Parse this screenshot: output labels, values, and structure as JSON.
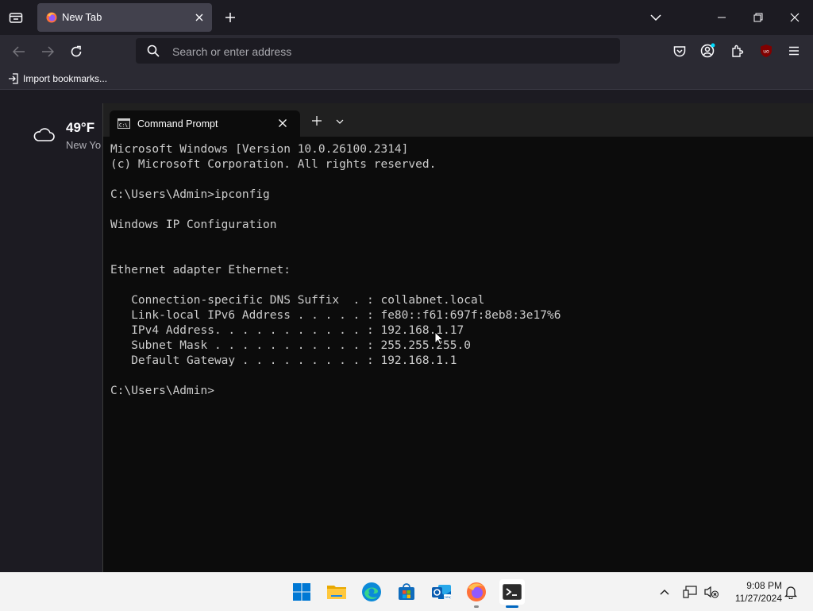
{
  "browser": {
    "tab": {
      "title": "New Tab"
    },
    "urlbar": {
      "placeholder": "Search or enter address"
    },
    "bookmarks": {
      "import_label": "Import bookmarks..."
    },
    "extension_badge": "uo"
  },
  "weather": {
    "temperature": "49°F",
    "location": "New Yo"
  },
  "terminal": {
    "tab_title": "Command Prompt",
    "output": [
      "Microsoft Windows [Version 10.0.26100.2314]",
      "(c) Microsoft Corporation. All rights reserved.",
      "",
      "C:\\Users\\Admin>ipconfig",
      "",
      "Windows IP Configuration",
      "",
      "",
      "Ethernet adapter Ethernet:",
      "",
      "   Connection-specific DNS Suffix  . : collabnet.local",
      "   Link-local IPv6 Address . . . . . : fe80::f61:697f:8eb8:3e17%6",
      "   IPv4 Address. . . . . . . . . . . : 192.168.1.17",
      "   Subnet Mask . . . . . . . . . . . : 255.255.255.0",
      "   Default Gateway . . . . . . . . . : 192.168.1.1",
      "",
      "C:\\Users\\Admin>"
    ]
  },
  "taskbar": {
    "apps": [
      "start",
      "file-explorer",
      "edge",
      "microsoft-store",
      "outlook",
      "firefox",
      "terminal"
    ],
    "clock": {
      "time": "9:08 PM",
      "date": "11/27/2024"
    }
  },
  "colors": {
    "accent": "#0067c0",
    "terminal_bg": "#0c0c0c",
    "terminal_text": "#cccccc",
    "browser_bg": "#1c1b22",
    "toolbar_bg": "#2b2a33"
  }
}
